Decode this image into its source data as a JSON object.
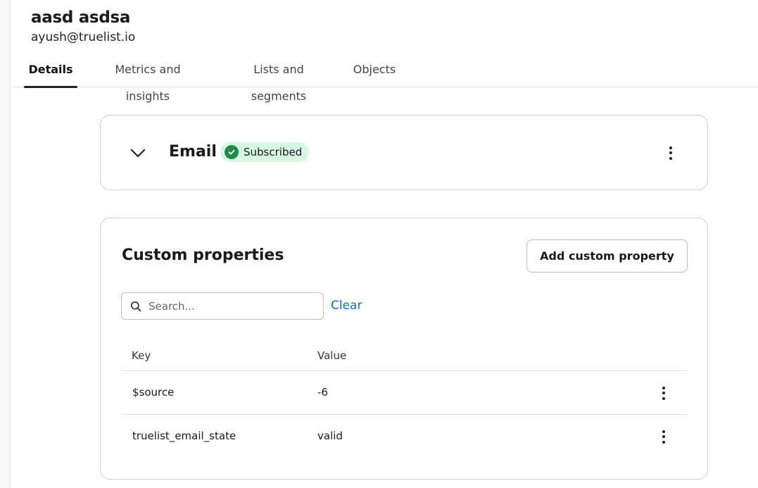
{
  "profile": {
    "name": "aasd asdsa",
    "email": "ayush@truelist.io"
  },
  "tabs": [
    {
      "label": "Details",
      "active": true
    },
    {
      "label": "Metrics and insights",
      "active": false
    },
    {
      "label": "Lists and segments",
      "active": false
    },
    {
      "label": "Objects",
      "active": false
    }
  ],
  "email_card": {
    "label": "Email",
    "status_badge": "Subscribed",
    "expand_icon": "chevron-down-icon",
    "menu_icon": "kebab-menu-icon",
    "badge_color": "#d7f6e1",
    "badge_icon_color": "#1f8a4c"
  },
  "custom_properties": {
    "title": "Custom properties",
    "add_button_label": "Add custom property",
    "search": {
      "placeholder": "Search...",
      "value": ""
    },
    "clear_label": "Clear",
    "columns": {
      "key": "Key",
      "value": "Value"
    },
    "rows": [
      {
        "key": "$source",
        "value": "-6"
      },
      {
        "key": "truelist_email_state",
        "value": "valid"
      }
    ]
  },
  "colors": {
    "link": "#1668d6",
    "active_tab_underline": "#222222"
  }
}
